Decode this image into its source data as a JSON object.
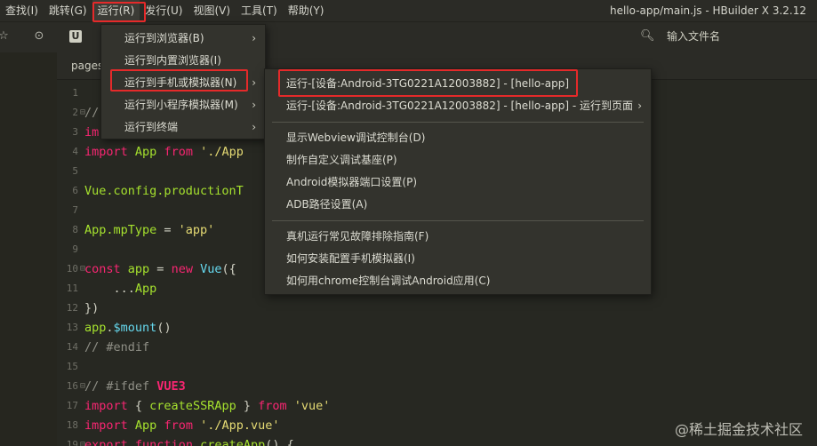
{
  "menubar": {
    "items": [
      "查找(I)",
      "跳转(G)",
      "运行(R)",
      "发行(U)",
      "视图(V)",
      "工具(T)",
      "帮助(Y)"
    ],
    "active_index": 2
  },
  "window": {
    "title": "hello-app/main.js - HBuilder X 3.2.12"
  },
  "toolbar": {
    "u_label": "U",
    "file_search_placeholder": "输入文件名"
  },
  "tabs": {
    "current": "pages"
  },
  "run_menu": {
    "items": [
      {
        "label": "运行到浏览器(B)",
        "has_submenu": true
      },
      {
        "label": "运行到内置浏览器(I)",
        "has_submenu": false
      },
      {
        "label": "运行到手机或模拟器(N)",
        "has_submenu": true
      },
      {
        "label": "运行到小程序模拟器(M)",
        "has_submenu": true
      },
      {
        "label": "运行到终端",
        "has_submenu": true
      }
    ],
    "highlighted_index": 2
  },
  "device_submenu": {
    "items": [
      {
        "label": "运行-[设备:Android-3TG0221A12003882] - [hello-app]",
        "has_submenu": false
      },
      {
        "label": "运行-[设备:Android-3TG0221A12003882] - [hello-app] - 运行到页面",
        "has_submenu": true
      },
      {
        "separator": true
      },
      {
        "label": "显示Webview调试控制台(D)",
        "has_submenu": false
      },
      {
        "label": "制作自定义调试基座(P)",
        "has_submenu": false
      },
      {
        "label": "Android模拟器端口设置(P)",
        "has_submenu": false
      },
      {
        "label": "ADB路径设置(A)",
        "has_submenu": false
      },
      {
        "separator": true
      },
      {
        "label": "真机运行常见故障排除指南(F)",
        "has_submenu": false
      },
      {
        "label": "如何安装配置手机模拟器(I)",
        "has_submenu": false
      },
      {
        "label": "如何用chrome控制台调试Android应用(C)",
        "has_submenu": false
      }
    ],
    "highlighted_index": 0
  },
  "editor": {
    "lines": [
      {
        "n": "1",
        "fold": "",
        "tokens": []
      },
      {
        "n": "2",
        "fold": "⊟",
        "tokens": [
          [
            "comment",
            "//"
          ]
        ]
      },
      {
        "n": "3",
        "fold": "",
        "tokens": [
          [
            "keyword",
            "im"
          ]
        ]
      },
      {
        "n": "4",
        "fold": "",
        "tokens": [
          [
            "keyword",
            "import"
          ],
          [
            "plain",
            " "
          ],
          [
            "ident",
            "App"
          ],
          [
            "plain",
            " "
          ],
          [
            "keyword",
            "from"
          ],
          [
            "plain",
            " "
          ],
          [
            "string",
            "'./App"
          ]
        ]
      },
      {
        "n": "5",
        "fold": "",
        "tokens": []
      },
      {
        "n": "6",
        "fold": "",
        "tokens": [
          [
            "ident",
            "Vue.config.productionT"
          ]
        ]
      },
      {
        "n": "7",
        "fold": "",
        "tokens": []
      },
      {
        "n": "8",
        "fold": "",
        "tokens": [
          [
            "ident",
            "App.mpType"
          ],
          [
            "plain",
            " = "
          ],
          [
            "string",
            "'app'"
          ]
        ]
      },
      {
        "n": "9",
        "fold": "",
        "tokens": []
      },
      {
        "n": "10",
        "fold": "⊟",
        "tokens": [
          [
            "keyword",
            "const"
          ],
          [
            "plain",
            " "
          ],
          [
            "ident",
            "app"
          ],
          [
            "plain",
            " = "
          ],
          [
            "keyword",
            "new"
          ],
          [
            "plain",
            " "
          ],
          [
            "func",
            "Vue"
          ],
          [
            "plain",
            "({"
          ]
        ]
      },
      {
        "n": "11",
        "fold": "",
        "tokens": [
          [
            "plain",
            "    ..."
          ],
          [
            "ident",
            "App"
          ]
        ]
      },
      {
        "n": "12",
        "fold": "",
        "tokens": [
          [
            "plain",
            "})"
          ]
        ]
      },
      {
        "n": "13",
        "fold": "",
        "tokens": [
          [
            "ident",
            "app"
          ],
          [
            "plain",
            "."
          ],
          [
            "func",
            "$mount"
          ],
          [
            "plain",
            "()"
          ]
        ]
      },
      {
        "n": "14",
        "fold": "",
        "tokens": [
          [
            "comment",
            "// #endif"
          ]
        ]
      },
      {
        "n": "15",
        "fold": "",
        "tokens": []
      },
      {
        "n": "16",
        "fold": "⊟",
        "tokens": [
          [
            "comment",
            "// #ifdef "
          ],
          [
            "macro",
            "VUE3"
          ]
        ]
      },
      {
        "n": "17",
        "fold": "",
        "tokens": [
          [
            "keyword",
            "import"
          ],
          [
            "plain",
            " { "
          ],
          [
            "ident",
            "createSSRApp"
          ],
          [
            "plain",
            " } "
          ],
          [
            "keyword",
            "from"
          ],
          [
            "plain",
            " "
          ],
          [
            "string",
            "'vue'"
          ]
        ]
      },
      {
        "n": "18",
        "fold": "",
        "tokens": [
          [
            "keyword",
            "import"
          ],
          [
            "plain",
            " "
          ],
          [
            "ident",
            "App"
          ],
          [
            "plain",
            " "
          ],
          [
            "keyword",
            "from"
          ],
          [
            "plain",
            " "
          ],
          [
            "string",
            "'./App.vue'"
          ]
        ]
      },
      {
        "n": "19",
        "fold": "⊟",
        "tokens": [
          [
            "keyword",
            "export"
          ],
          [
            "plain",
            " "
          ],
          [
            "keyword",
            "function"
          ],
          [
            "plain",
            " "
          ],
          [
            "ident",
            "createApp"
          ],
          [
            "plain",
            "() {"
          ]
        ]
      }
    ]
  },
  "watermark": "@稀土掘金技术社区"
}
